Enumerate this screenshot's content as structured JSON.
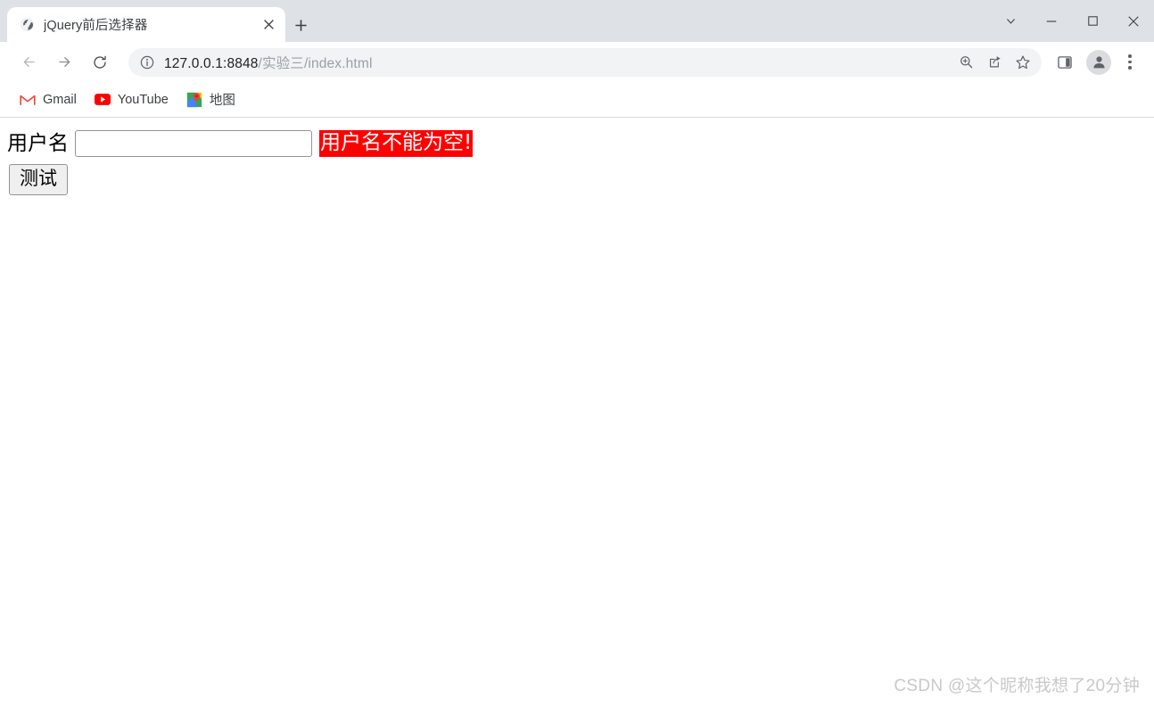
{
  "window": {
    "controls": [
      {
        "name": "tab-search",
        "glyph": "chevron-down"
      },
      {
        "name": "minimize",
        "glyph": "minus"
      },
      {
        "name": "maximize",
        "glyph": "square"
      },
      {
        "name": "close",
        "glyph": "cross"
      }
    ]
  },
  "tabstrip": {
    "tabs": [
      {
        "title": "jQuery前后选择器",
        "favicon": "globe-icon",
        "active": true
      }
    ],
    "new_tab_label": "+",
    "close_label": "×"
  },
  "toolbar": {
    "back": "back-arrow-icon",
    "forward": "forward-arrow-icon",
    "reload": "reload-icon",
    "omnibox": {
      "security_icon": "info-circle-icon",
      "url_host": "127.0.0.1:8848",
      "url_path": "/实验三/index.html",
      "url_full": "127.0.0.1:8848/实验三/index.html",
      "actions": [
        "zoom-icon",
        "share-icon",
        "bookmark-star-icon"
      ]
    },
    "side_panel": "side-panel-icon",
    "profile": "profile-avatar-icon",
    "menu": "three-dot-menu-icon"
  },
  "bookmarks": {
    "items": [
      {
        "label": "Gmail",
        "icon": "gmail-icon"
      },
      {
        "label": "YouTube",
        "icon": "youtube-icon"
      },
      {
        "label": "地图",
        "icon": "google-maps-icon"
      }
    ]
  },
  "page": {
    "form": {
      "username_label": "用户名",
      "username_value": "",
      "username_placeholder": "",
      "error_message": "用户名不能为空!",
      "error_bg": "#ff0000",
      "error_color": "#ffffff",
      "submit_label": "测试"
    },
    "watermark": "CSDN @这个昵称我想了20分钟"
  }
}
